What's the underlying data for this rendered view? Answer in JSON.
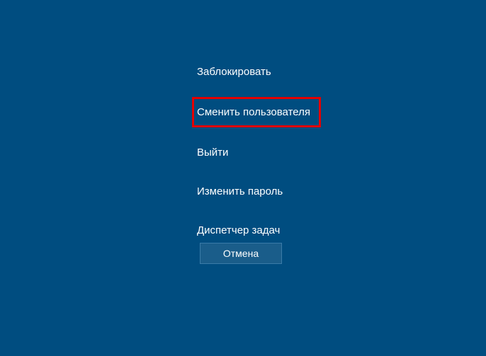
{
  "menu": {
    "items": [
      {
        "label": "Заблокировать",
        "highlighted": false
      },
      {
        "label": "Сменить пользователя",
        "highlighted": true
      },
      {
        "label": "Выйти",
        "highlighted": false
      },
      {
        "label": "Изменить пароль",
        "highlighted": false
      },
      {
        "label": "Диспетчер задач",
        "highlighted": false
      }
    ]
  },
  "cancel": {
    "label": "Отмена"
  }
}
